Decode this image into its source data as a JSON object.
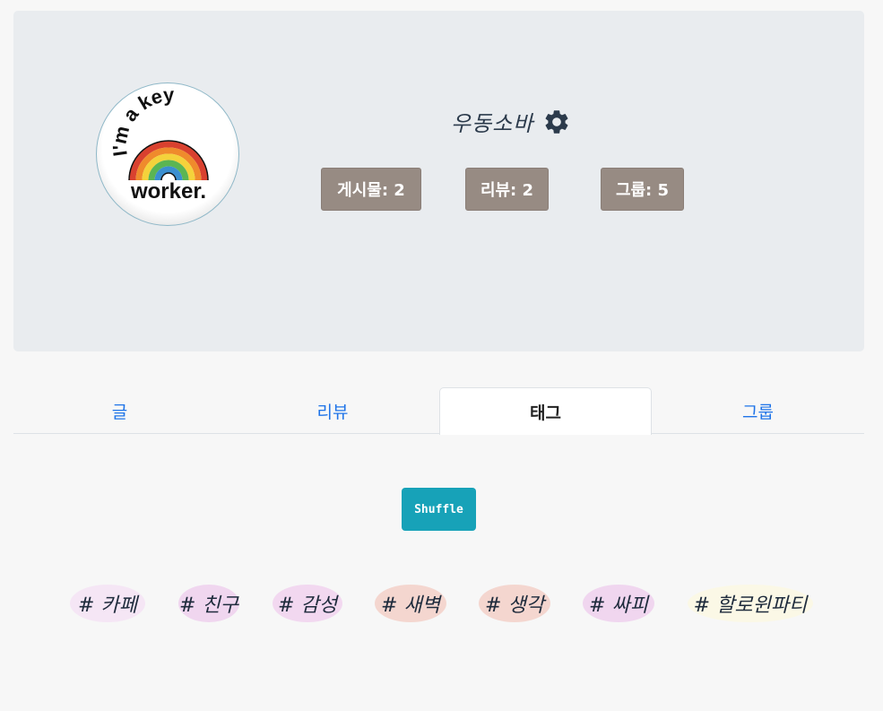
{
  "profile": {
    "avatar_text_top": "I'm a key",
    "avatar_text_bottom": "worker.",
    "username": "우동소바",
    "settings_icon": "gear-icon",
    "stats": {
      "posts": "게시물: 2",
      "reviews": "리뷰: 2",
      "groups": "그룹: 5"
    }
  },
  "tabs": [
    {
      "label": "글"
    },
    {
      "label": "리뷰"
    },
    {
      "label": "태그",
      "active": true
    },
    {
      "label": "그룹"
    }
  ],
  "shuffle_label": "Shuffle",
  "tags": [
    {
      "label": "# 카페",
      "color": "#f5e6f5"
    },
    {
      "label": "# 친구",
      "color": "#f0d6ef"
    },
    {
      "label": "# 감성",
      "color": "#f2d8f0"
    },
    {
      "label": "# 새벽",
      "color": "#f4d6cf"
    },
    {
      "label": "# 생각",
      "color": "#f4d6cf"
    },
    {
      "label": "# 싸피",
      "color": "#f0d6ef"
    },
    {
      "label": "# 할로윈파티",
      "color": "#fbf8e6"
    }
  ],
  "colors": {
    "card_bg": "#e9ecef",
    "stat_bg": "#978b83",
    "tab_link": "#1f74e8",
    "shuffle_bg": "#17a2b8"
  }
}
